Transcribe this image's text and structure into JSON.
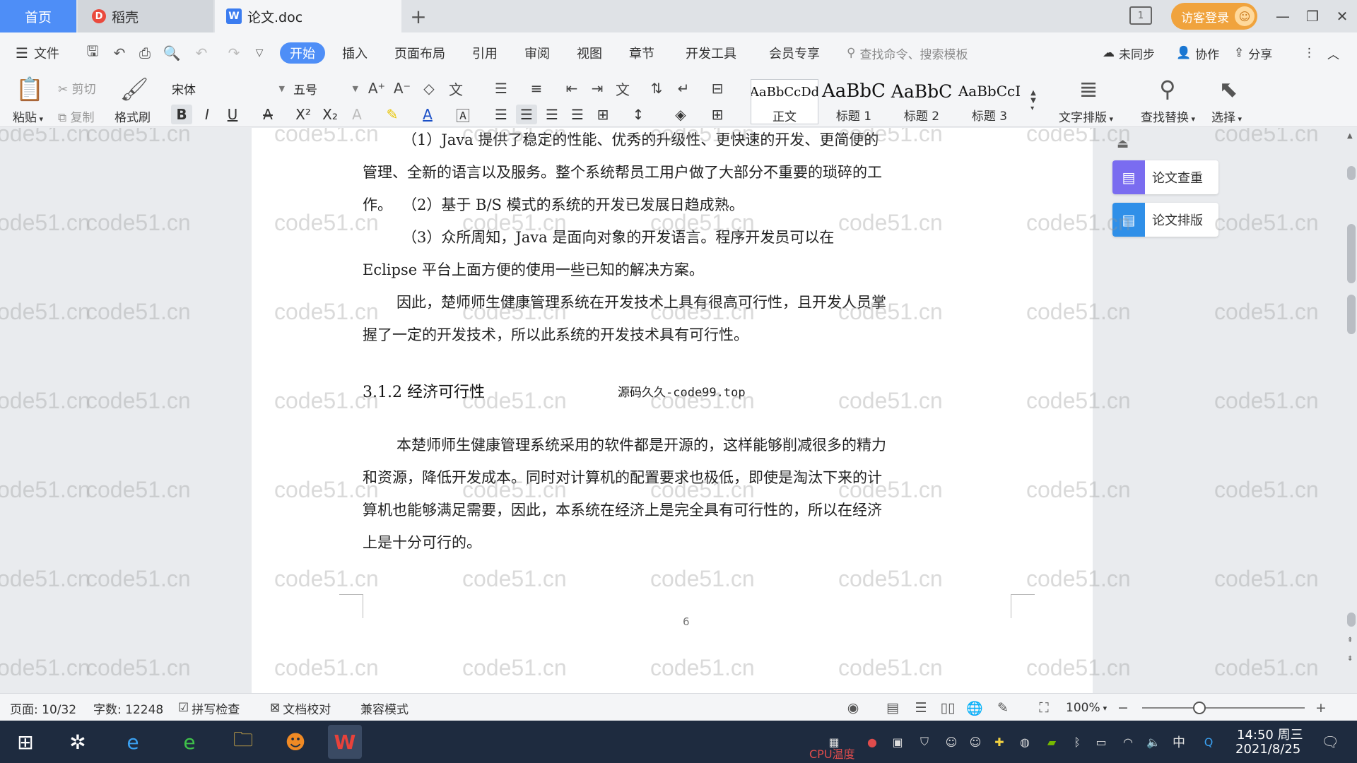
{
  "tabs": {
    "home": "首页",
    "docer": "稻壳",
    "document": "论文.doc",
    "guest_login": "访客登录"
  },
  "menu": {
    "file": "文件",
    "items": [
      "开始",
      "插入",
      "页面布局",
      "引用",
      "审阅",
      "视图",
      "章节",
      "开发工具",
      "会员专享"
    ],
    "search_placeholder": "查找命令、搜索模板",
    "unsynced": "未同步",
    "collaborate": "协作",
    "share": "分享"
  },
  "ribbon": {
    "paste": "粘贴",
    "cut": "剪切",
    "copy": "复制",
    "format_painter": "格式刷",
    "font_name": "宋体",
    "font_size": "五号",
    "styles": [
      {
        "sample": "AaBbCcDd",
        "name": "正文"
      },
      {
        "sample": "AaBbC",
        "name": "标题 1"
      },
      {
        "sample": "AaBbC",
        "name": "标题 2"
      },
      {
        "sample": "AaBbCcI",
        "name": "标题 3"
      }
    ],
    "text_layout": "文字排版",
    "find_replace": "查找替换",
    "select": "选择"
  },
  "document": {
    "paragraphs": [
      "（1）Java 提供了稳定的性能、优秀的升级性、更快速的开发、更简便的管理、全新的语言以及服务。整个系统帮员工用户做了大部分不重要的琐碎的工作。",
      "（2）基于 B/S 模式的系统的开发已发展日趋成熟。",
      "（3）众所周知，Java 是面向对象的开发语言。程序开发员可以在 Eclipse 平台上面方便的使用一些已知的解决方案。",
      "因此，楚师师生健康管理系统在开发技术上具有很高可行性，且开发人员掌握了一定的开发技术，所以此系统的开发技术具有可行性。"
    ],
    "heading": "3.1.2 经济可行性",
    "annotation": "源码久久-code99.top",
    "paragraph_after": "本楚师师生健康管理系统采用的软件都是开源的，这样能够削减很多的精力和资源，降低开发成本。同时对计算机的配置要求也极低，即使是淘汰下来的计算机也能够满足需要，因此，本系统在经济上是完全具有可行性的，所以在经济上是十分可行的。",
    "page_number": "6",
    "watermark": "code51.cn"
  },
  "side_panel": {
    "check": "论文查重",
    "layout": "论文排版"
  },
  "status": {
    "page": "页面: 10/32",
    "words": "字数: 12248",
    "spell_check": "拼写检查",
    "doc_proof": "文档校对",
    "compat_mode": "兼容模式",
    "zoom": "100%",
    "zoom_level": 0.35
  },
  "taskbar": {
    "time": "14:50 周三",
    "date": "2021/8/25",
    "cpu_label": "CPU温度",
    "ime": "中"
  }
}
